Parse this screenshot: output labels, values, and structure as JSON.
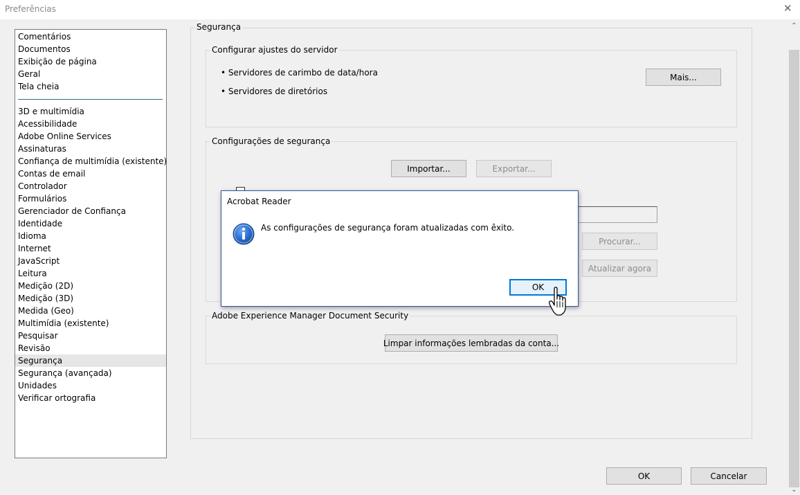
{
  "window": {
    "title": "Preferências",
    "close_glyph": "✕"
  },
  "categories": {
    "top": [
      "Comentários",
      "Documentos",
      "Exibição de página",
      "Geral",
      "Tela cheia"
    ],
    "bottom": [
      "3D e multimídia",
      "Acessibilidade",
      "Adobe Online Services",
      "Assinaturas",
      "Confiança de multimídia (existente)",
      "Contas de email",
      "Controlador",
      "Formulários",
      "Gerenciador de Confiança",
      "Identidade",
      "Idioma",
      "Internet",
      "JavaScript",
      "Leitura",
      "Medição (2D)",
      "Medição (3D)",
      "Medida (Geo)",
      "Multimídia (existente)",
      "Pesquisar",
      "Revisão",
      "Segurança",
      "Segurança (avançada)",
      "Unidades",
      "Verificar ortografia"
    ],
    "selected": "Segurança"
  },
  "panel": {
    "title": "Segurança",
    "server": {
      "title": "Configurar ajustes do servidor",
      "items": [
        "• Servidores de carimbo de data/hora",
        "• Servidores de diretórios"
      ],
      "more_button": "Mais..."
    },
    "security_settings": {
      "title": "Configurações de segurança",
      "import_button": "Importar...",
      "export_button": "Exportar...",
      "browse_button": "Procurar...",
      "update_now_button": "Atualizar agora"
    },
    "aem": {
      "title": "Adobe Experience Manager Document Security",
      "clear_button": "Limpar informações lembradas da conta..."
    }
  },
  "footer": {
    "ok_button": "OK",
    "cancel_button": "Cancelar"
  },
  "modal": {
    "title": "Acrobat Reader",
    "message": "As configurações de segurança foram atualizadas com êxito.",
    "ok_button": "OK",
    "icon": "info-icon"
  },
  "scrollbar": {
    "up_glyph": "⌃",
    "down_glyph": "⌄"
  },
  "colors": {
    "accent": "#0078d7",
    "info_icon": "#1c5fb8",
    "separator": "#2d6e8e"
  }
}
